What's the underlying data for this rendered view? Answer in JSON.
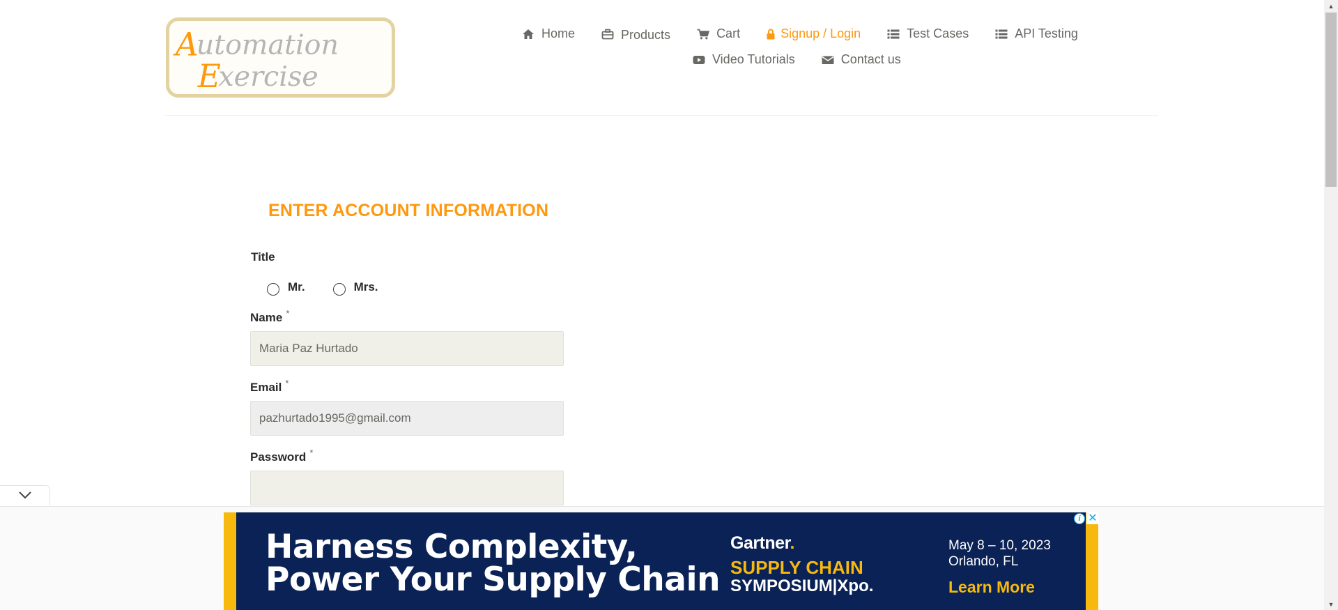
{
  "header": {
    "logo_line1": "Automation",
    "logo_line2": "Exercise",
    "nav": {
      "home": "Home",
      "products": "Products",
      "cart": "Cart",
      "signup_login": "Signup / Login",
      "test_cases": "Test Cases",
      "api_testing": "API Testing",
      "video_tutorials": "Video Tutorials",
      "contact_us": "Contact us"
    },
    "active_color": "#fe980f"
  },
  "form": {
    "title": "ENTER ACCOUNT INFORMATION",
    "title_label": "Title",
    "title_options": [
      "Mr.",
      "Mrs."
    ],
    "name_label": "Name",
    "name_value": "Maria Paz Hurtado",
    "email_label": "Email",
    "email_value": "pazhurtado1995@gmail.com",
    "password_label": "Password",
    "password_value": "",
    "required_mark": "*"
  },
  "ad": {
    "headline_line1": "Harness Complexity,",
    "headline_line2": "Power Your Supply Chain",
    "brand": "Gartner",
    "brand_dot": ".",
    "event_line1": "SUPPLY CHAIN",
    "event_line2": "SYMPOSIUM|Xpo.",
    "date_line1": "May 8 – 10, 2023",
    "date_line2": "Orlando, FL",
    "cta": "Learn More",
    "info_glyph": "i",
    "close_glyph": "✕",
    "colors": {
      "background": "#0b2256",
      "accent": "#f7b90d"
    }
  }
}
